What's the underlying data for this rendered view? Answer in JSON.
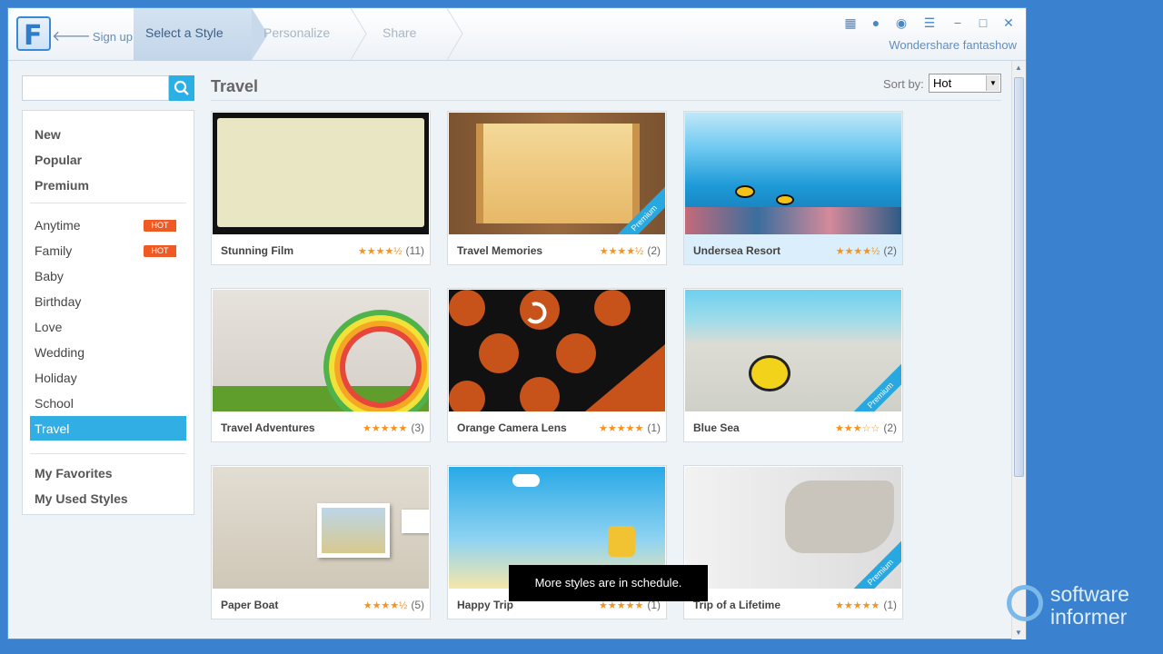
{
  "topbar": {
    "logo_letter": "F",
    "signup": "Sign up",
    "steps": [
      "Select a Style",
      "Personalize",
      "Share"
    ],
    "brand": "Wondershare fantashow"
  },
  "search": {
    "placeholder": ""
  },
  "sidebar": {
    "top": [
      "New",
      "Popular",
      "Premium"
    ],
    "categories": [
      {
        "label": "Anytime",
        "badge": "HOT"
      },
      {
        "label": "Family",
        "badge": "HOT"
      },
      {
        "label": "Baby"
      },
      {
        "label": "Birthday"
      },
      {
        "label": "Love"
      },
      {
        "label": "Wedding"
      },
      {
        "label": "Holiday"
      },
      {
        "label": "School"
      },
      {
        "label": "Travel"
      }
    ],
    "bottom": [
      "My Favorites",
      "My Used Styles"
    ]
  },
  "main": {
    "title": "Travel",
    "sort_label": "Sort by:",
    "sort_value": "Hot"
  },
  "cards": [
    {
      "name": "Stunning Film",
      "stars": "★★★★½",
      "count": "(11)"
    },
    {
      "name": "Travel Memories",
      "stars": "★★★★½",
      "count": "(2)",
      "badge": "Premium"
    },
    {
      "name": "Undersea Resort",
      "stars": "★★★★½",
      "count": "(2)"
    },
    {
      "name": "Travel Adventures",
      "stars": "★★★★★",
      "count": "(3)"
    },
    {
      "name": "Orange Camera Lens",
      "stars": "★★★★★",
      "count": "(1)"
    },
    {
      "name": "Blue Sea",
      "stars": "★★★☆☆",
      "count": "(2)",
      "badge": "Premium"
    },
    {
      "name": "Paper Boat",
      "stars": "★★★★½",
      "count": "(5)"
    },
    {
      "name": "Happy Trip",
      "stars": "★★★★★",
      "count": "(1)"
    },
    {
      "name": "Trip of a Lifetime",
      "stars": "★★★★★",
      "count": "(1)",
      "badge": "Premium"
    }
  ],
  "tooltip": "More styles are in schedule.",
  "watermark": [
    "software",
    "informer"
  ],
  "colors": {
    "accent": "#31aee3",
    "hot": "#ef5a24",
    "star": "#f5931e",
    "frame": "#3a82cf"
  }
}
